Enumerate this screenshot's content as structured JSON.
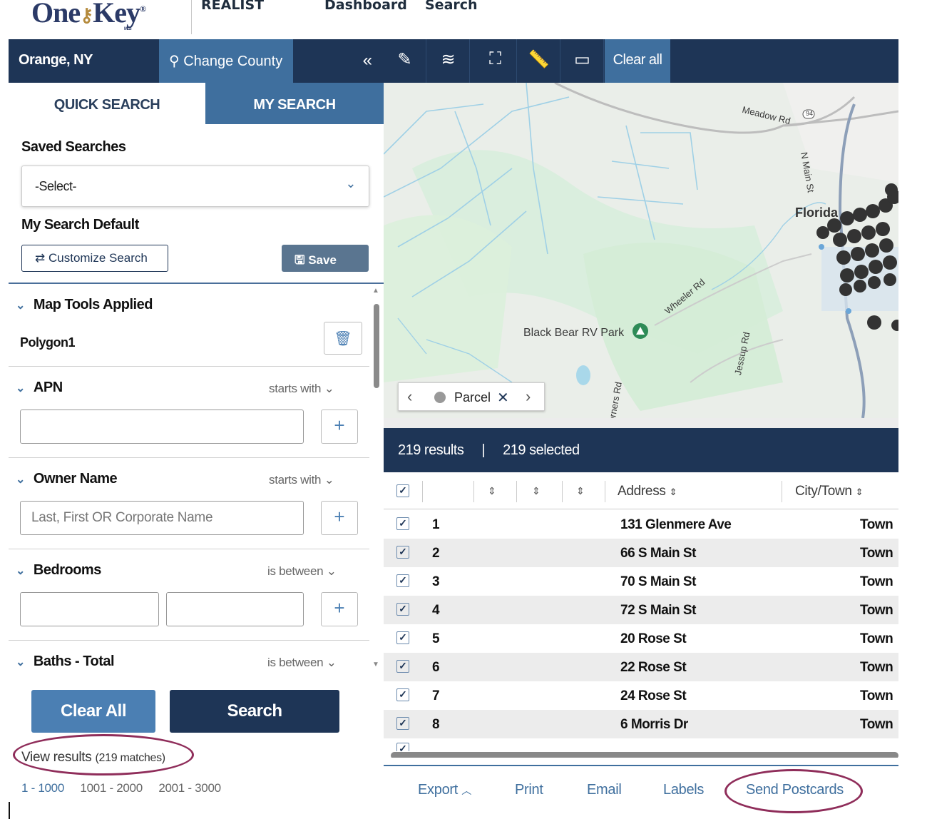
{
  "header": {
    "logo_text_1": "One",
    "logo_text_2": "Key",
    "logo_sub": "MLS",
    "product": "REALIST",
    "nav_dashboard": "Dashboard",
    "nav_search": "Search"
  },
  "sidebar": {
    "county": "Orange, NY",
    "change_county": "Change County",
    "collapse_icon": "«",
    "tabs": {
      "quick": "QUICK SEARCH",
      "my": "MY SEARCH"
    },
    "saved_searches_label": "Saved Searches",
    "saved_searches_value": "-Select-",
    "my_search_default_label": "My Search Default",
    "customize_label": "Customize Search",
    "save_label": "Save",
    "map_tools_title": "Map Tools Applied",
    "polygon_label": "Polygon1",
    "apn_title": "APN",
    "apn_condition": "starts with",
    "owner_title": "Owner Name",
    "owner_condition": "starts with",
    "owner_placeholder": "Last, First OR Corporate Name",
    "bedrooms_title": "Bedrooms",
    "bedrooms_condition": "is between",
    "baths_title": "Baths - Total",
    "baths_condition": "is between",
    "clear_all": "Clear All",
    "search": "Search",
    "view_results": "View results",
    "view_results_count": "(219 matches)",
    "pages": [
      "1 - 1000",
      "1001 - 2000",
      "2001 - 3000"
    ]
  },
  "map_toolbar": {
    "tools": [
      "pencil-icon",
      "layers-icon",
      "map-icon",
      "ruler-icon",
      "comment-icon"
    ],
    "clear_all": "Clear all"
  },
  "map": {
    "labels": {
      "black_bear": "Black Bear RV Park",
      "florida": "Florida",
      "meadow_rd": "Meadow Rd",
      "wheeler_rd": "Wheeler Rd",
      "jessup_rd": "Jessup Rd",
      "n_main_st": "N Main St",
      "corners_rd": "orners Rd",
      "route_94": "94"
    },
    "layer_name": "Parcel"
  },
  "results": {
    "count_text": "219 results",
    "selected_text": "219 selected",
    "columns": {
      "address": "Address",
      "city": "City/Town"
    },
    "rows": [
      {
        "num": "1",
        "address": "131 Glenmere Ave",
        "city": "Town"
      },
      {
        "num": "2",
        "address": "66 S Main St",
        "city": "Town"
      },
      {
        "num": "3",
        "address": "70 S Main St",
        "city": "Town"
      },
      {
        "num": "4",
        "address": "72 S Main St",
        "city": "Town"
      },
      {
        "num": "5",
        "address": "20 Rose St",
        "city": "Town"
      },
      {
        "num": "6",
        "address": "22 Rose St",
        "city": "Town"
      },
      {
        "num": "7",
        "address": "24 Rose St",
        "city": "Town"
      },
      {
        "num": "8",
        "address": "6 Morris Dr",
        "city": "Town"
      }
    ]
  },
  "actions": {
    "export": "Export",
    "print": "Print",
    "email": "Email",
    "labels": "Labels",
    "send_postcards": "Send Postcards"
  },
  "colors": {
    "navy": "#1e3556",
    "accent_blue": "#3f6f9e",
    "annotation": "#8f2d5a"
  }
}
